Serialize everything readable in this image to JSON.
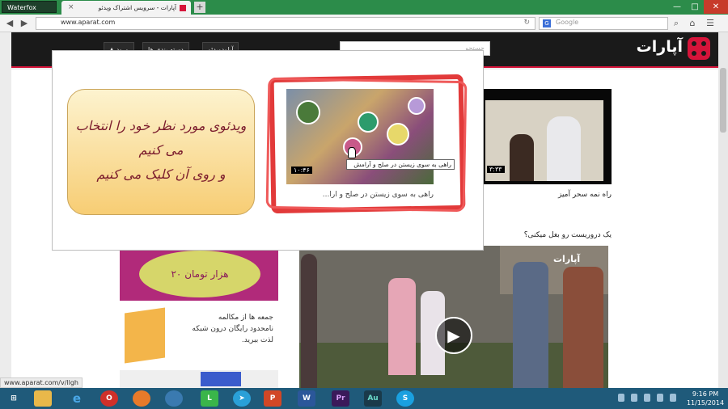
{
  "browser": {
    "menu_label": "Waterfox",
    "tab_title": "آپارات - سرویس اشتراک ویدئو",
    "tab_close": "×",
    "new_tab": "+",
    "url": "www.aparat.com",
    "search_engine_icon": "G",
    "search_placeholder": "Google",
    "status_url": "www.aparat.com/v/llgh",
    "window_min": "—",
    "window_max": "□",
    "window_close": "✕"
  },
  "site": {
    "logo_text": "آپارات",
    "search_placeholder": "جستجو",
    "header_buttons": [
      "ورود",
      "دسته بندی ها",
      "آپلودویدئو"
    ]
  },
  "overlay": {
    "note_lines": [
      "ویدئوی مورد نظر خود را انتخاب",
      "می کنیم",
      "و روی آن کلیک می کنیم"
    ],
    "thumb_duration": "۱۰:۴۶",
    "tooltip": "راهی به سوی زیستن در صلح و آرامش",
    "thumb_caption": "راهی به سوی زیستن در صلح و آرا..."
  },
  "content": {
    "right_video_duration": "۳:۳۳",
    "right_video_caption": "راه نمه سحر آمیز",
    "section_title": "یک دروریست رو بغل میکنی؟",
    "promo_text": "۲۰ هزار تومان",
    "promo2_lines": [
      "جمعه ها از مکالمه",
      "نامحدود رایگان درون شبکه",
      "لذت ببرید."
    ],
    "video_logo": "آپارات"
  },
  "taskbar": {
    "icons": [
      "windows-icon",
      "file-explorer-icon",
      "internet-explorer-icon",
      "opera-icon",
      "firefox-icon",
      "chrome-icon",
      "line-icon",
      "telegram-icon",
      "powerpoint-icon",
      "word-icon",
      "premiere-icon",
      "audition-icon",
      "skype-icon"
    ],
    "time": "9:16 PM",
    "date": "11/15/2014"
  },
  "colors": {
    "accent": "#d6143a",
    "taskbar": "#1f5a7a",
    "browser_tabbar": "#2c8c4a",
    "highlight": "#e23a3a"
  }
}
